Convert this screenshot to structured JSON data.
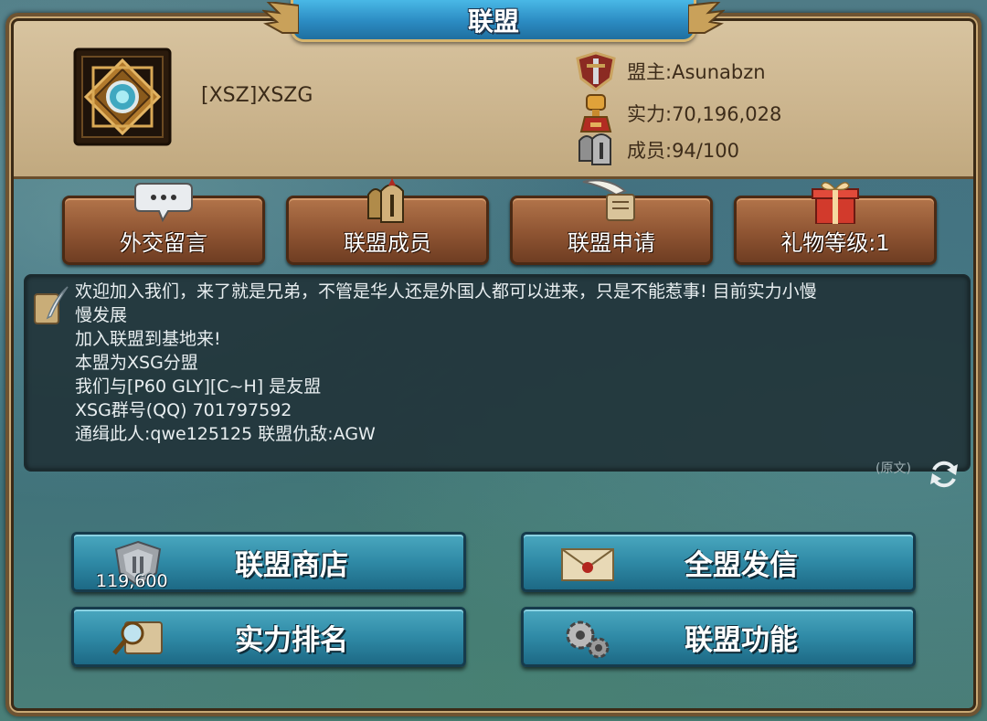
{
  "window": {
    "title": "联盟"
  },
  "alliance": {
    "name": "[XSZ]XSZG",
    "leader": "盟主:Asunabzn",
    "power": "实力:70,196,028",
    "members": "成员:94/100"
  },
  "tabs": [
    {
      "label": "外交留言",
      "icon": "speech-bubble-icon"
    },
    {
      "label": "联盟成员",
      "icon": "helmet-icon"
    },
    {
      "label": "联盟申请",
      "icon": "quill-scroll-icon"
    },
    {
      "label": "礼物等级:1",
      "icon": "gift-icon"
    }
  ],
  "message": {
    "lines": [
      "欢迎加入我们，来了就是兄弟，不管是华人还是外国人都可以进来，只是不能惹事! 目前实力小慢",
      "慢发展",
      "加入联盟到基地来!",
      "本盟为XSG分盟",
      "我们与[P60 GLY][C~H] 是友盟",
      "XSG群号(QQ) 701797592",
      "通缉此人:qwe125125 联盟仇敌:AGW"
    ],
    "original_label": "(原文)"
  },
  "actions": {
    "shop": {
      "label": "联盟商店",
      "count": "119,600"
    },
    "mail": {
      "label": "全盟发信"
    },
    "ranking": {
      "label": "实力排名"
    },
    "functions": {
      "label": "联盟功能"
    }
  },
  "colors": {
    "title_bar": "#2b8bc2",
    "header_bg": "#cbb48d",
    "tab_button": "#8e5432",
    "action_button": "#2f8aa6",
    "message_bg": "#22343a"
  }
}
